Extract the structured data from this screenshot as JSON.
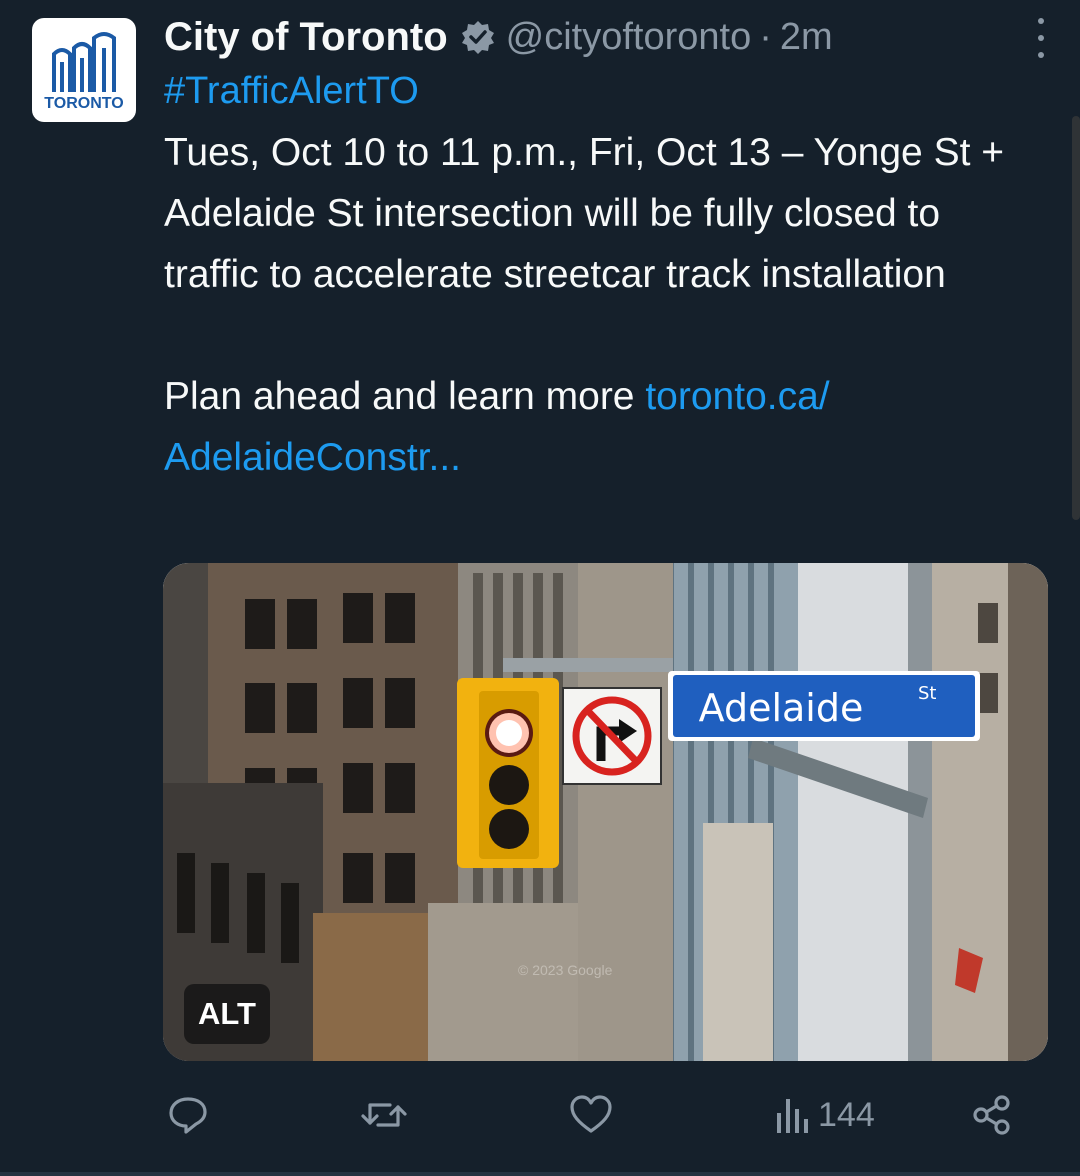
{
  "tweet": {
    "display_name": "City of Toronto",
    "handle": "@cityoftoronto",
    "separator": "·",
    "time": "2m",
    "hashtag": "#TrafficAlertTO",
    "body_line1": "Tues, Oct 10 to 11 p.m., Fri, Oct 13 – Yonge St + Adelaide St intersection will be fully closed to traffic to accelerate streetcar track installation",
    "body_line2_text": "Plan ahead and learn more ",
    "body_link": "toronto.ca/ AdelaideConstr..."
  },
  "avatar": {
    "logo_text": "TORONTO",
    "brand_color": "#1b5aa6"
  },
  "media": {
    "street_sign": "Adelaide",
    "street_sign_suffix": "St",
    "street_sign_color": "#1f5fbf",
    "watermark": "© 2023 Google",
    "alt_label": "ALT"
  },
  "actions": {
    "reply_icon": "reply-icon",
    "retweet_icon": "retweet-icon",
    "like_icon": "heart-icon",
    "views_icon": "views-chart-icon",
    "views_count": "144",
    "share_icon": "share-icon"
  },
  "colors": {
    "background": "#15202b",
    "link": "#1d9bf0",
    "muted": "#8b98a5",
    "verified_badge": "#8b98a5"
  }
}
